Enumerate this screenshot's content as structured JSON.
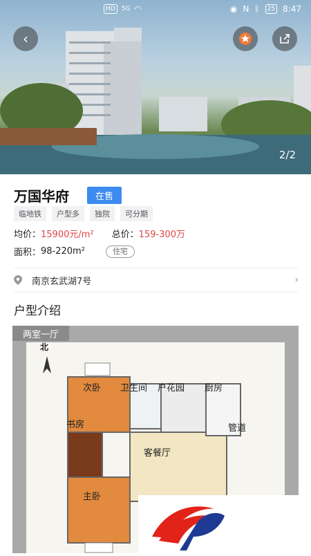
{
  "status_bar": {
    "hd": "HD",
    "network": "5G",
    "battery": "25",
    "time": "8:47"
  },
  "hero": {
    "counter": "2/2"
  },
  "property": {
    "name": "万国华府",
    "status_badge": "在售",
    "tags": [
      "临地铁",
      "户型多",
      "独院",
      "可分期"
    ],
    "avg_price_label": "均价：",
    "avg_price_value": "15900元/m²",
    "total_price_label": "总价：",
    "total_price_value": "159-300万",
    "area_label": "面积：",
    "area_value": "98-220m²",
    "type_chip": "住宅",
    "address": "南京玄武湖7号"
  },
  "section": {
    "layout_title": "户型介绍"
  },
  "floorplan": {
    "tab_label": "两室一厅",
    "north": "北",
    "rooms": [
      "次卧",
      "卫生间",
      "户花园",
      "厨房",
      "书房",
      "管道",
      "客餐厅",
      "主卧"
    ]
  },
  "colors": {
    "accent": "#3d8bf0",
    "price": "#e04545"
  }
}
